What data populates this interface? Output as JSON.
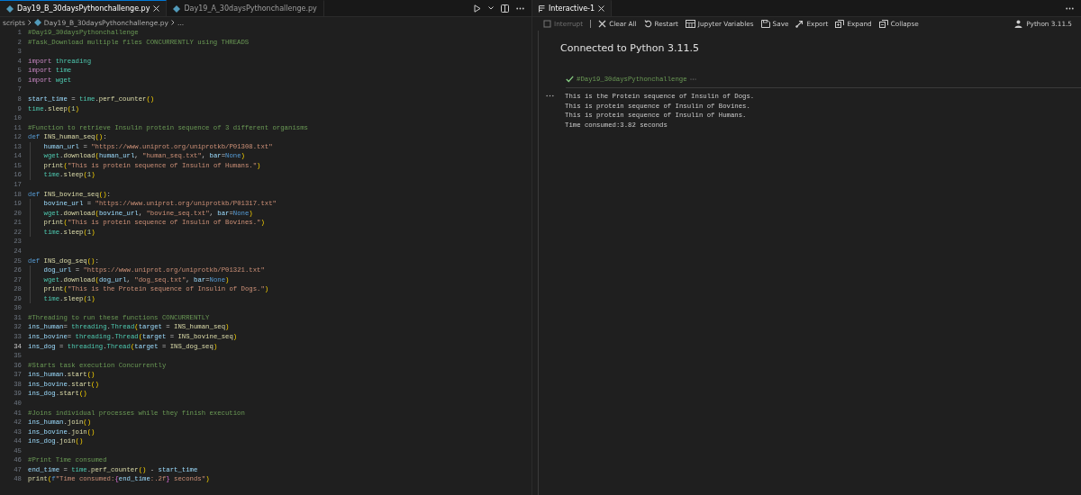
{
  "editor": {
    "tabs": [
      {
        "label": "Day19_B_30daysPythonchallenge.py",
        "selected": true
      },
      {
        "label": "Day19_A_30daysPythonchallenge.py",
        "selected": false
      }
    ],
    "breadcrumb": {
      "folder": "scripts",
      "file": "Day19_B_30daysPythonchallenge.py",
      "more": "..."
    },
    "lines": [
      {
        "number": "1",
        "active": false,
        "indent": false,
        "tokens": [
          {
            "kind": "comment",
            "text": "#Day19_30daysPythonchallenge"
          }
        ]
      },
      {
        "number": "2",
        "active": false,
        "indent": false,
        "tokens": [
          {
            "kind": "comment",
            "text": "#Task_Download multiple files CONCURRENTLY using THREADS"
          }
        ]
      },
      {
        "number": "3",
        "active": false
      },
      {
        "number": "4",
        "active": false,
        "indent": false,
        "tokens": [
          {
            "kind": "keyword",
            "text": "import "
          },
          {
            "kind": "module",
            "text": "threading"
          }
        ]
      },
      {
        "number": "5",
        "active": false,
        "indent": false,
        "tokens": [
          {
            "kind": "keyword",
            "text": "import "
          },
          {
            "kind": "module",
            "text": "time"
          }
        ]
      },
      {
        "number": "6",
        "active": false,
        "indent": false,
        "tokens": [
          {
            "kind": "keyword",
            "text": "import "
          },
          {
            "kind": "module",
            "text": "wget"
          }
        ]
      },
      {
        "number": "7",
        "active": false
      },
      {
        "number": "8",
        "active": false,
        "indent": false,
        "tokens": [
          {
            "kind": "variable",
            "text": "start_time"
          },
          {
            "kind": "plain",
            "text": " = "
          },
          {
            "kind": "module",
            "text": "time"
          },
          {
            "kind": "plain",
            "text": "."
          },
          {
            "kind": "function",
            "text": "perf_counter"
          },
          {
            "kind": "bracket",
            "text": "()"
          }
        ]
      },
      {
        "number": "9",
        "active": false,
        "indent": false,
        "tokens": [
          {
            "kind": "module",
            "text": "time"
          },
          {
            "kind": "plain",
            "text": "."
          },
          {
            "kind": "function",
            "text": "sleep"
          },
          {
            "kind": "bracket",
            "text": "("
          },
          {
            "kind": "number",
            "text": "1"
          },
          {
            "kind": "bracket",
            "text": ")"
          }
        ]
      },
      {
        "number": "10",
        "active": false
      },
      {
        "number": "11",
        "active": false,
        "indent": false,
        "tokens": [
          {
            "kind": "comment",
            "text": "#Function to retrieve Insulin protein sequence of 3 different organisms"
          }
        ]
      },
      {
        "number": "12",
        "active": false,
        "indent": false,
        "tokens": [
          {
            "kind": "storage",
            "text": "def "
          },
          {
            "kind": "function",
            "text": "INS_human_seq"
          },
          {
            "kind": "bracket",
            "text": "()"
          },
          {
            "kind": "plain",
            "text": ":"
          }
        ]
      },
      {
        "number": "13",
        "active": false,
        "indent": true,
        "tokens": [
          {
            "kind": "variable",
            "text": "human_url"
          },
          {
            "kind": "plain",
            "text": " = "
          },
          {
            "kind": "string",
            "text": "\"https://www.uniprot.org/uniprotkb/P01308.txt\""
          }
        ]
      },
      {
        "number": "14",
        "active": false,
        "indent": true,
        "tokens": [
          {
            "kind": "module",
            "text": "wget"
          },
          {
            "kind": "plain",
            "text": "."
          },
          {
            "kind": "function",
            "text": "download"
          },
          {
            "kind": "bracket",
            "text": "("
          },
          {
            "kind": "variable",
            "text": "human_url"
          },
          {
            "kind": "plain",
            "text": ", "
          },
          {
            "kind": "string",
            "text": "\"human_seq.txt\""
          },
          {
            "kind": "plain",
            "text": ", "
          },
          {
            "kind": "variable",
            "text": "bar"
          },
          {
            "kind": "plain",
            "text": "="
          },
          {
            "kind": "storage",
            "text": "None"
          },
          {
            "kind": "bracket",
            "text": ")"
          }
        ]
      },
      {
        "number": "15",
        "active": false,
        "indent": true,
        "tokens": [
          {
            "kind": "function",
            "text": "print"
          },
          {
            "kind": "bracket",
            "text": "("
          },
          {
            "kind": "string",
            "text": "\"This is protein sequence of Insulin of Humans.\""
          },
          {
            "kind": "bracket",
            "text": ")"
          }
        ]
      },
      {
        "number": "16",
        "active": false,
        "indent": true,
        "tokens": [
          {
            "kind": "module",
            "text": "time"
          },
          {
            "kind": "plain",
            "text": "."
          },
          {
            "kind": "function",
            "text": "sleep"
          },
          {
            "kind": "bracket",
            "text": "("
          },
          {
            "kind": "number",
            "text": "1"
          },
          {
            "kind": "bracket",
            "text": ")"
          }
        ]
      },
      {
        "number": "17",
        "active": false
      },
      {
        "number": "18",
        "active": false,
        "indent": false,
        "tokens": [
          {
            "kind": "storage",
            "text": "def "
          },
          {
            "kind": "function",
            "text": "INS_bovine_seq"
          },
          {
            "kind": "bracket",
            "text": "()"
          },
          {
            "kind": "plain",
            "text": ":"
          }
        ]
      },
      {
        "number": "19",
        "active": false,
        "indent": true,
        "tokens": [
          {
            "kind": "variable",
            "text": "bovine_url"
          },
          {
            "kind": "plain",
            "text": " = "
          },
          {
            "kind": "string",
            "text": "\"https://www.uniprot.org/uniprotkb/P01317.txt\""
          }
        ]
      },
      {
        "number": "20",
        "active": false,
        "indent": true,
        "tokens": [
          {
            "kind": "module",
            "text": "wget"
          },
          {
            "kind": "plain",
            "text": "."
          },
          {
            "kind": "function",
            "text": "download"
          },
          {
            "kind": "bracket",
            "text": "("
          },
          {
            "kind": "variable",
            "text": "bovine_url"
          },
          {
            "kind": "plain",
            "text": ", "
          },
          {
            "kind": "string",
            "text": "\"bovine_seq.txt\""
          },
          {
            "kind": "plain",
            "text": ", "
          },
          {
            "kind": "variable",
            "text": "bar"
          },
          {
            "kind": "plain",
            "text": "="
          },
          {
            "kind": "storage",
            "text": "None"
          },
          {
            "kind": "bracket",
            "text": ")"
          }
        ]
      },
      {
        "number": "21",
        "active": false,
        "indent": true,
        "tokens": [
          {
            "kind": "function",
            "text": "print"
          },
          {
            "kind": "bracket",
            "text": "("
          },
          {
            "kind": "string",
            "text": "\"This is protein sequence of Insulin of Bovines.\""
          },
          {
            "kind": "bracket",
            "text": ")"
          }
        ]
      },
      {
        "number": "22",
        "active": false,
        "indent": true,
        "tokens": [
          {
            "kind": "module",
            "text": "time"
          },
          {
            "kind": "plain",
            "text": "."
          },
          {
            "kind": "function",
            "text": "sleep"
          },
          {
            "kind": "bracket",
            "text": "("
          },
          {
            "kind": "number",
            "text": "1"
          },
          {
            "kind": "bracket",
            "text": ")"
          }
        ]
      },
      {
        "number": "23",
        "active": false
      },
      {
        "number": "24",
        "active": false
      },
      {
        "number": "25",
        "active": false,
        "indent": false,
        "tokens": [
          {
            "kind": "storage",
            "text": "def "
          },
          {
            "kind": "function",
            "text": "INS_dog_seq"
          },
          {
            "kind": "bracket",
            "text": "()"
          },
          {
            "kind": "plain",
            "text": ":"
          }
        ]
      },
      {
        "number": "26",
        "active": false,
        "indent": true,
        "tokens": [
          {
            "kind": "variable",
            "text": "dog_url"
          },
          {
            "kind": "plain",
            "text": " = "
          },
          {
            "kind": "string",
            "text": "\"https://www.uniprot.org/uniprotkb/P01321.txt\""
          }
        ]
      },
      {
        "number": "27",
        "active": false,
        "indent": true,
        "tokens": [
          {
            "kind": "module",
            "text": "wget"
          },
          {
            "kind": "plain",
            "text": "."
          },
          {
            "kind": "function",
            "text": "download"
          },
          {
            "kind": "bracket",
            "text": "("
          },
          {
            "kind": "variable",
            "text": "dog_url"
          },
          {
            "kind": "plain",
            "text": ", "
          },
          {
            "kind": "string",
            "text": "\"dog_seq.txt\""
          },
          {
            "kind": "plain",
            "text": ", "
          },
          {
            "kind": "variable",
            "text": "bar"
          },
          {
            "kind": "plain",
            "text": "="
          },
          {
            "kind": "storage",
            "text": "None"
          },
          {
            "kind": "bracket",
            "text": ")"
          }
        ]
      },
      {
        "number": "28",
        "active": false,
        "indent": true,
        "tokens": [
          {
            "kind": "function",
            "text": "print"
          },
          {
            "kind": "bracket",
            "text": "("
          },
          {
            "kind": "string",
            "text": "\"This is the Protein sequence of Insulin of Dogs.\""
          },
          {
            "kind": "bracket",
            "text": ")"
          }
        ]
      },
      {
        "number": "29",
        "active": false,
        "indent": true,
        "tokens": [
          {
            "kind": "module",
            "text": "time"
          },
          {
            "kind": "plain",
            "text": "."
          },
          {
            "kind": "function",
            "text": "sleep"
          },
          {
            "kind": "bracket",
            "text": "("
          },
          {
            "kind": "number",
            "text": "1"
          },
          {
            "kind": "bracket",
            "text": ")"
          }
        ]
      },
      {
        "number": "30",
        "active": false
      },
      {
        "number": "31",
        "active": false,
        "indent": false,
        "tokens": [
          {
            "kind": "comment",
            "text": "#Threading to run these functions CONCURRENTLY"
          }
        ]
      },
      {
        "number": "32",
        "active": false,
        "indent": false,
        "tokens": [
          {
            "kind": "variable",
            "text": "ins_human"
          },
          {
            "kind": "plain",
            "text": "= "
          },
          {
            "kind": "module",
            "text": "threading"
          },
          {
            "kind": "plain",
            "text": "."
          },
          {
            "kind": "module",
            "text": "Thread"
          },
          {
            "kind": "bracket",
            "text": "("
          },
          {
            "kind": "variable",
            "text": "target"
          },
          {
            "kind": "plain",
            "text": " = "
          },
          {
            "kind": "function",
            "text": "INS_human_seq"
          },
          {
            "kind": "bracket",
            "text": ")"
          }
        ]
      },
      {
        "number": "33",
        "active": false,
        "indent": false,
        "tokens": [
          {
            "kind": "variable",
            "text": "ins_bovine"
          },
          {
            "kind": "plain",
            "text": "= "
          },
          {
            "kind": "module",
            "text": "threading"
          },
          {
            "kind": "plain",
            "text": "."
          },
          {
            "kind": "module",
            "text": "Thread"
          },
          {
            "kind": "bracket",
            "text": "("
          },
          {
            "kind": "variable",
            "text": "target"
          },
          {
            "kind": "plain",
            "text": " = "
          },
          {
            "kind": "function",
            "text": "INS_bovine_seq"
          },
          {
            "kind": "bracket",
            "text": ")"
          }
        ]
      },
      {
        "number": "34",
        "active": true,
        "indent": false,
        "tokens": [
          {
            "kind": "variable",
            "text": "ins_dog"
          },
          {
            "kind": "plain",
            "text": " = "
          },
          {
            "kind": "module",
            "text": "threading"
          },
          {
            "kind": "plain",
            "text": "."
          },
          {
            "kind": "module",
            "text": "Thread"
          },
          {
            "kind": "bracket",
            "text": "("
          },
          {
            "kind": "variable",
            "text": "target"
          },
          {
            "kind": "plain",
            "text": " = "
          },
          {
            "kind": "function",
            "text": "INS_dog_seq"
          },
          {
            "kind": "bracket",
            "text": ")"
          }
        ]
      },
      {
        "number": "35",
        "active": false
      },
      {
        "number": "36",
        "active": false,
        "indent": false,
        "tokens": [
          {
            "kind": "comment",
            "text": "#Starts task execution Concurrently"
          }
        ]
      },
      {
        "number": "37",
        "active": false,
        "indent": false,
        "tokens": [
          {
            "kind": "variable",
            "text": "ins_human"
          },
          {
            "kind": "plain",
            "text": "."
          },
          {
            "kind": "function",
            "text": "start"
          },
          {
            "kind": "bracket",
            "text": "()"
          }
        ]
      },
      {
        "number": "38",
        "active": false,
        "indent": false,
        "tokens": [
          {
            "kind": "variable",
            "text": "ins_bovine"
          },
          {
            "kind": "plain",
            "text": "."
          },
          {
            "kind": "function",
            "text": "start"
          },
          {
            "kind": "bracket",
            "text": "()"
          }
        ]
      },
      {
        "number": "39",
        "active": false,
        "indent": false,
        "tokens": [
          {
            "kind": "variable",
            "text": "ins_dog"
          },
          {
            "kind": "plain",
            "text": "."
          },
          {
            "kind": "function",
            "text": "start"
          },
          {
            "kind": "bracket",
            "text": "()"
          }
        ]
      },
      {
        "number": "40",
        "active": false
      },
      {
        "number": "41",
        "active": false,
        "indent": false,
        "tokens": [
          {
            "kind": "comment",
            "text": "#Joins individual processes while they finish execution"
          }
        ]
      },
      {
        "number": "42",
        "active": false,
        "indent": false,
        "tokens": [
          {
            "kind": "variable",
            "text": "ins_human"
          },
          {
            "kind": "plain",
            "text": "."
          },
          {
            "kind": "function",
            "text": "join"
          },
          {
            "kind": "bracket",
            "text": "()"
          }
        ]
      },
      {
        "number": "43",
        "active": false,
        "indent": false,
        "tokens": [
          {
            "kind": "variable",
            "text": "ins_bovine"
          },
          {
            "kind": "plain",
            "text": "."
          },
          {
            "kind": "function",
            "text": "join"
          },
          {
            "kind": "bracket",
            "text": "()"
          }
        ]
      },
      {
        "number": "44",
        "active": false,
        "indent": false,
        "tokens": [
          {
            "kind": "variable",
            "text": "ins_dog"
          },
          {
            "kind": "plain",
            "text": "."
          },
          {
            "kind": "function",
            "text": "join"
          },
          {
            "kind": "bracket",
            "text": "()"
          }
        ]
      },
      {
        "number": "45",
        "active": false
      },
      {
        "number": "46",
        "active": false,
        "indent": false,
        "tokens": [
          {
            "kind": "comment",
            "text": "#Print Time consumed"
          }
        ]
      },
      {
        "number": "47",
        "active": false,
        "indent": false,
        "tokens": [
          {
            "kind": "variable",
            "text": "end_time"
          },
          {
            "kind": "plain",
            "text": " = "
          },
          {
            "kind": "module",
            "text": "time"
          },
          {
            "kind": "plain",
            "text": "."
          },
          {
            "kind": "function",
            "text": "perf_counter"
          },
          {
            "kind": "bracket",
            "text": "()"
          },
          {
            "kind": "plain",
            "text": " - "
          },
          {
            "kind": "variable",
            "text": "start_time"
          }
        ]
      },
      {
        "number": "48",
        "active": false,
        "indent": false,
        "tokens": [
          {
            "kind": "function",
            "text": "print"
          },
          {
            "kind": "bracket",
            "text": "("
          },
          {
            "kind": "storage",
            "text": "f"
          },
          {
            "kind": "string",
            "text": "\"Time consumed:"
          },
          {
            "kind": "brace",
            "text": "{"
          },
          {
            "kind": "variable",
            "text": "end_time"
          },
          {
            "kind": "string",
            "text": ":.2f"
          },
          {
            "kind": "brace",
            "text": "}"
          },
          {
            "kind": "string",
            "text": " seconds\""
          },
          {
            "kind": "bracket",
            "text": ")"
          }
        ]
      }
    ]
  },
  "interactive": {
    "tab": {
      "label": "Interactive-1",
      "selected": true
    },
    "toolbar": [
      {
        "kind": "interrupt",
        "label": "Interrupt",
        "disabled": true
      },
      {
        "kind": "clear",
        "label": "Clear All",
        "disabled": false
      },
      {
        "kind": "restart",
        "label": "Restart",
        "disabled": false
      },
      {
        "kind": "variables",
        "label": "Jupyter Variables",
        "disabled": false
      },
      {
        "kind": "save",
        "label": "Save",
        "disabled": false
      },
      {
        "kind": "export",
        "label": "Export",
        "disabled": false
      },
      {
        "kind": "expand",
        "label": "Expand",
        "disabled": false
      },
      {
        "kind": "collapse",
        "label": "Collapse",
        "disabled": false
      }
    ],
    "kernel": "Python 3.11.5",
    "status": "Connected to Python 3.11.5",
    "cell": {
      "code": "#Day19_30daysPythonchallenge",
      "succeeded": true,
      "output": [
        "This is the Protein sequence of Insulin of Dogs.",
        "This is protein sequence of Insulin of Bovines.",
        "This is protein sequence of Insulin of Humans.",
        "Time consumed:3.82 seconds"
      ]
    }
  }
}
